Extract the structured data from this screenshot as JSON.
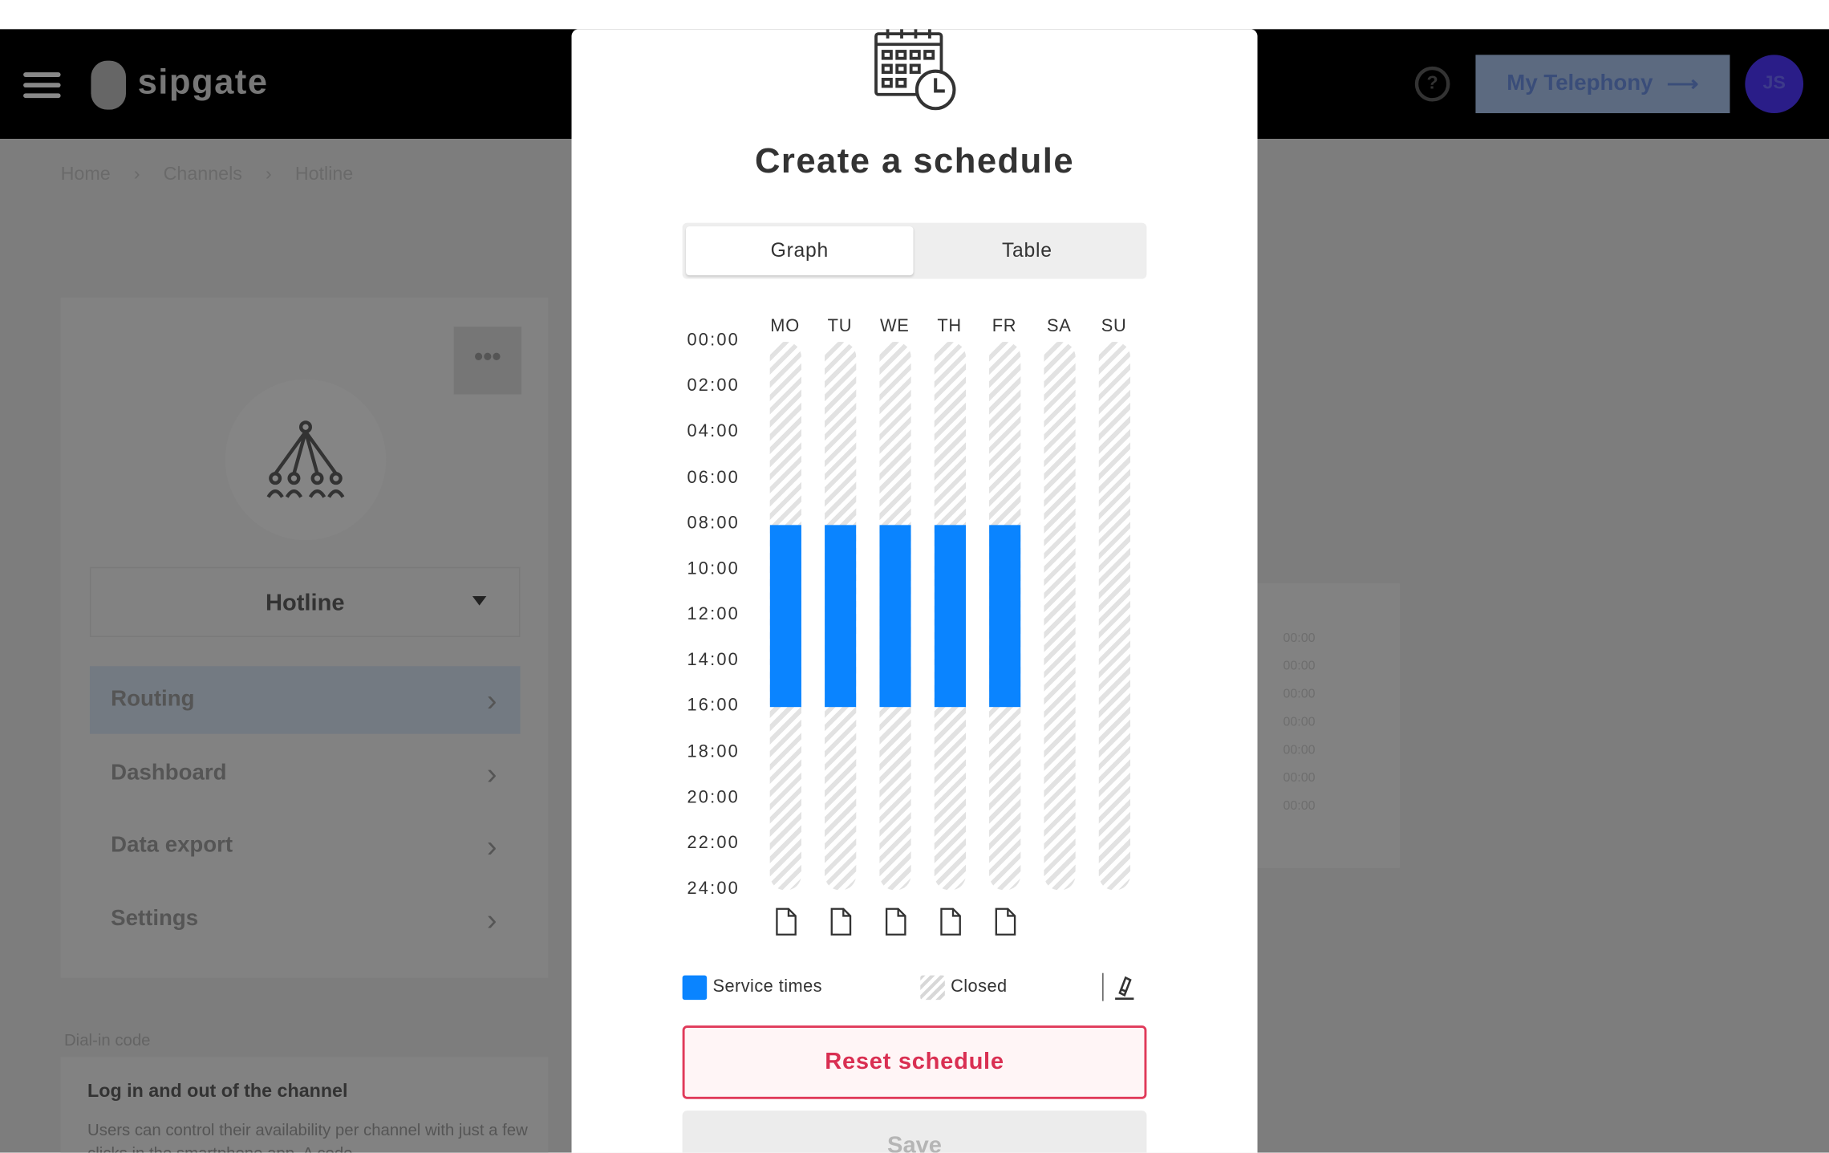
{
  "app": {
    "logo_text": "sipgate",
    "telephony_button": "My Telephony",
    "telephony_arrow": "⟶",
    "avatar_initials": "JS",
    "help_glyph": "?"
  },
  "breadcrumb": [
    "Home",
    "Channels",
    "Hotline"
  ],
  "breadcrumb_sep": "›",
  "channel_card": {
    "more_glyph": "•••",
    "channel_name": "Hotline",
    "nav": [
      "Routing",
      "Dashboard",
      "Data export",
      "Settings"
    ],
    "nav_chevron": "›"
  },
  "dial_in": {
    "label": "Dial-in code",
    "title": "Log in and out of the channel",
    "description": "Users can control their availability per channel with just a few clicks in the smartphone app. A code"
  },
  "background_times": [
    "00:00",
    "00:00",
    "00:00",
    "00:00",
    "00:00",
    "00:00",
    "00:00"
  ],
  "modal": {
    "title": "Create a schedule",
    "tabs": {
      "graph": "Graph",
      "table": "Table"
    },
    "active_tab": "graph",
    "time_labels": [
      "00:00",
      "02:00",
      "04:00",
      "06:00",
      "08:00",
      "10:00",
      "12:00",
      "14:00",
      "16:00",
      "18:00",
      "20:00",
      "22:00",
      "24:00"
    ],
    "days": [
      "MO",
      "TU",
      "WE",
      "TH",
      "FR",
      "SA",
      "SU"
    ],
    "service_hours": [
      {
        "day": "MO",
        "start": 8,
        "end": 16
      },
      {
        "day": "TU",
        "start": 8,
        "end": 16
      },
      {
        "day": "WE",
        "start": 8,
        "end": 16
      },
      {
        "day": "TH",
        "start": 8,
        "end": 16
      },
      {
        "day": "FR",
        "start": 8,
        "end": 16
      },
      {
        "day": "SA",
        "start": null,
        "end": null
      },
      {
        "day": "SU",
        "start": null,
        "end": null
      }
    ],
    "legend": {
      "service": "Service times",
      "closed": "Closed"
    },
    "colors": {
      "service": "#0a84ff",
      "reset": "#d92f52"
    },
    "reset_label": "Reset schedule",
    "save_label": "Save"
  }
}
